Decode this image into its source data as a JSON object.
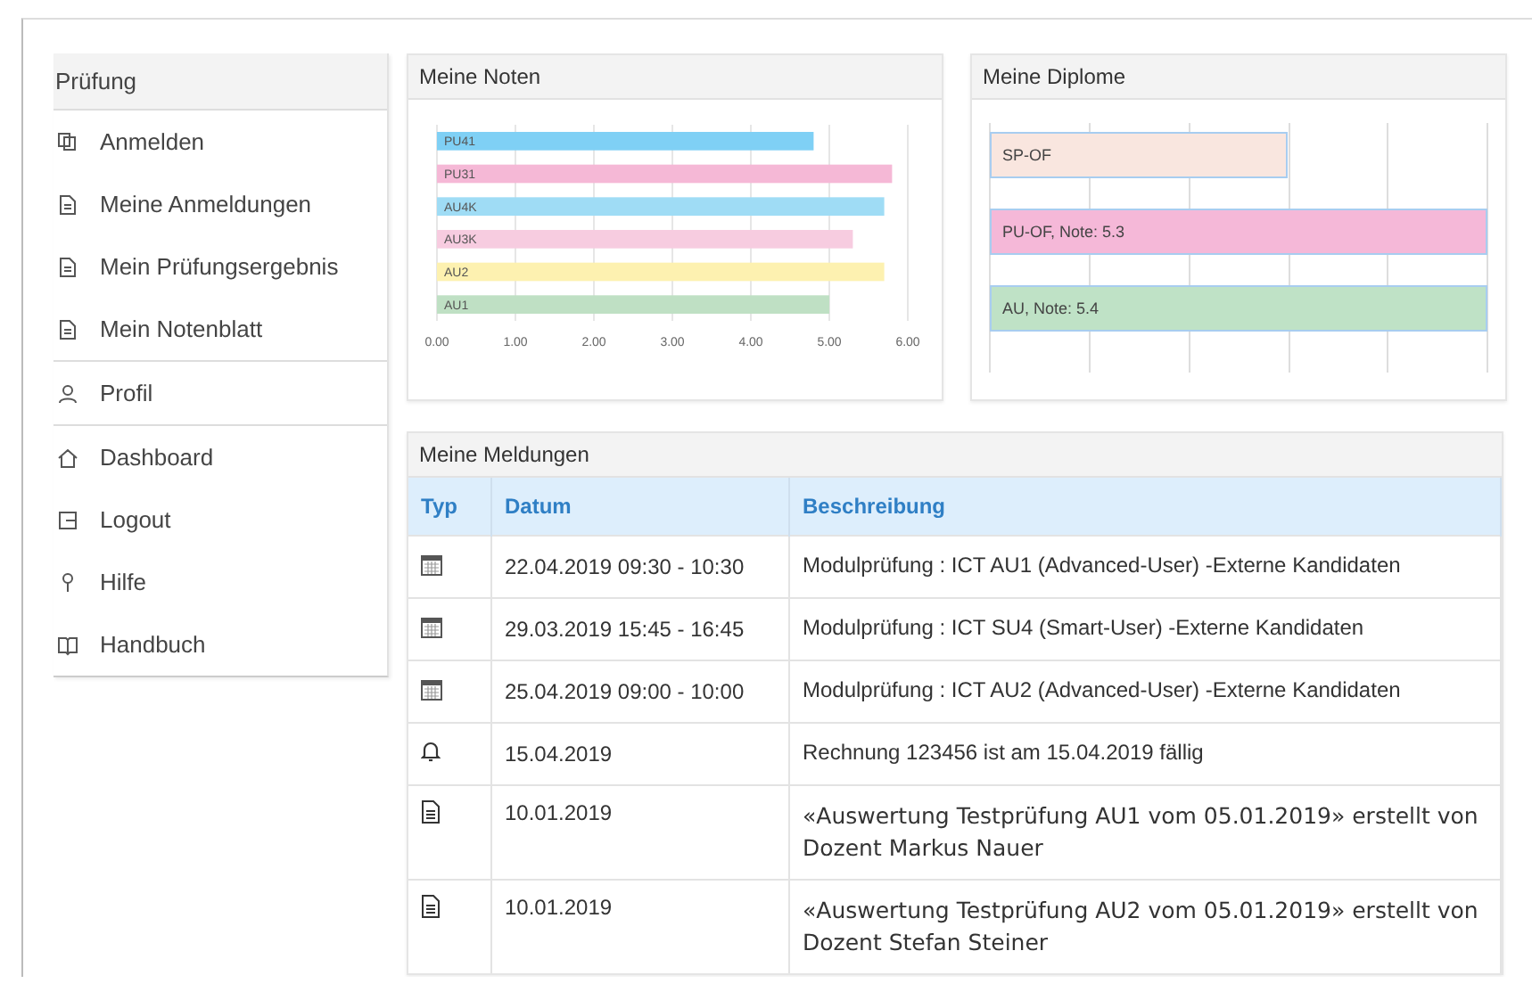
{
  "sidebar": {
    "heading": "Prüfung",
    "groups": [
      [
        {
          "label": "Anmelden",
          "kind": "copy"
        },
        {
          "label": "Meine Anmeldungen",
          "kind": "doc"
        },
        {
          "label": "Mein Prüfungsergebnis",
          "kind": "doc"
        },
        {
          "label": "Mein Notenblatt",
          "kind": "doc"
        }
      ],
      [
        {
          "label": "Profil",
          "kind": "user"
        }
      ],
      [
        {
          "label": "Dashboard",
          "kind": "home"
        },
        {
          "label": "Logout",
          "kind": "logout"
        },
        {
          "label": "Hilfe",
          "kind": "help"
        },
        {
          "label": "Handbuch",
          "kind": "book"
        }
      ]
    ]
  },
  "grades": {
    "title": "Meine Noten",
    "chart_data": {
      "type": "bar",
      "orientation": "horizontal",
      "categories": [
        "PU41",
        "PU31",
        "AU4K",
        "AU3K",
        "AU2",
        "AU1"
      ],
      "values": [
        4.8,
        5.8,
        5.7,
        5.3,
        5.7,
        5.0
      ],
      "colors": [
        "#7fd0f5",
        "#f5b8d6",
        "#9fdcf5",
        "#f7cce0",
        "#fdf1b0",
        "#bfe0c4"
      ],
      "xlim": [
        0,
        6
      ],
      "grid": true,
      "xticks": [
        {
          "value": 0,
          "label": "0.00"
        },
        {
          "value": 1,
          "label": "1.00"
        },
        {
          "value": 2,
          "label": "2.00"
        },
        {
          "value": 3,
          "label": "3.00"
        },
        {
          "value": 4,
          "label": "4.00"
        },
        {
          "value": 5,
          "label": "5.00"
        },
        {
          "value": 6,
          "label": "6.00"
        }
      ]
    }
  },
  "diplomas": {
    "title": "Meine Diplome",
    "bars": [
      {
        "label": "SP-OF",
        "color": "#f9e6df"
      },
      {
        "label": "PU-OF, Note: 5.3",
        "color": "#f5b8d8"
      },
      {
        "label": "AU, Note: 5.4",
        "color": "#bfe2c6"
      }
    ]
  },
  "messages": {
    "title": "Meine Meldungen",
    "columns": [
      "Typ",
      "Datum",
      "Beschreibung"
    ],
    "rows": [
      {
        "kind": "calendar",
        "date": "22.04.2019 09:30 - 10:30",
        "text": "Modulprüfung : ICT AU1 (Advanced-User) -Externe Kandidaten"
      },
      {
        "kind": "calendar",
        "date": "29.03.2019 15:45 - 16:45",
        "text": "Modulprüfung : ICT SU4 (Smart-User) -Externe Kandidaten"
      },
      {
        "kind": "calendar",
        "date": "25.04.2019 09:00 - 10:00",
        "text": "Modulprüfung : ICT AU2 (Advanced-User) -Externe Kandidaten"
      },
      {
        "kind": "bell",
        "date": "15.04.2019",
        "text": "Rechnung 123456 ist am 15.04.2019 fällig"
      },
      {
        "kind": "document",
        "date": "10.01.2019",
        "text": "«Auswertung Testprüfung AU1 vom 05.01.2019» erstellt von Dozent Markus Nauer"
      },
      {
        "kind": "document",
        "date": "10.01.2019",
        "text": "«Auswertung Testprüfung AU2 vom 05.01.2019» erstellt von Dozent Stefan Steiner"
      }
    ]
  }
}
